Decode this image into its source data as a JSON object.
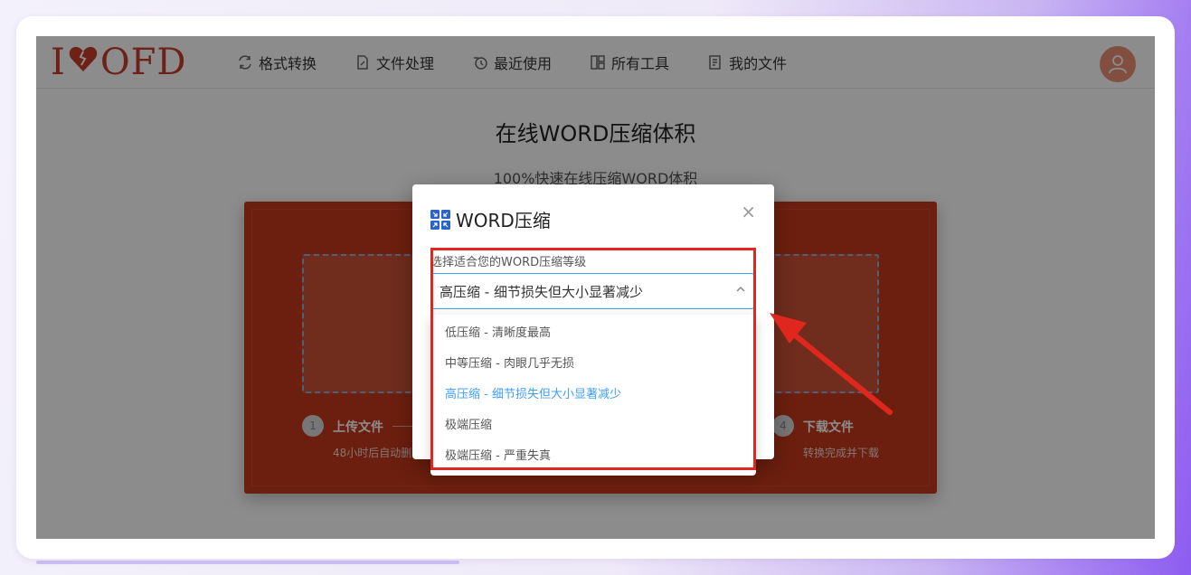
{
  "logo": {
    "text_left": "I",
    "text_right": "OFD"
  },
  "nav": {
    "items": [
      {
        "label": "格式转换",
        "icon": "convert-icon"
      },
      {
        "label": "文件处理",
        "icon": "file-edit-icon"
      },
      {
        "label": "最近使用",
        "icon": "clock-icon"
      },
      {
        "label": "所有工具",
        "icon": "grid-icon"
      },
      {
        "label": "我的文件",
        "icon": "document-icon"
      }
    ]
  },
  "page": {
    "title": "在线WORD压缩体积",
    "subtitle": "100%快速在线压缩WORD体积"
  },
  "steps": [
    {
      "num": "1",
      "title": "上传文件",
      "desc": "48小时后自动删"
    },
    {
      "num": "4",
      "title": "下载文件",
      "desc": "转换完成并下载"
    }
  ],
  "dialog": {
    "title": "WORD压缩",
    "close": "×",
    "field_label": "选择适合您的WORD压缩等级",
    "selected_value": "高压缩 - 细节损失但大小显著减少",
    "options": [
      "低压缩 - 清晰度最高",
      "中等压缩 - 肉眼几乎无损",
      "高压缩 - 细节损失但大小显著减少",
      "极端压缩",
      "极端压缩 - 严重失真"
    ],
    "selected_index": 2
  },
  "colors": {
    "brand": "#c83d28",
    "accent": "#409eff",
    "highlight": "#e0271e"
  }
}
